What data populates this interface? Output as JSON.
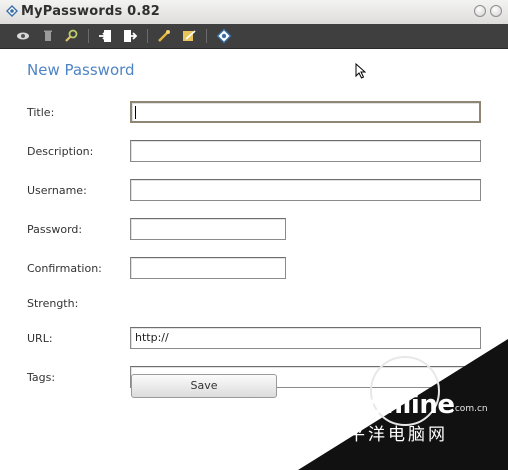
{
  "window": {
    "title": "MyPasswords 0.82",
    "icons": [
      "app-logo-icon",
      "minimize-icon",
      "close-icon"
    ]
  },
  "toolbar": {
    "buttons": [
      "view-icon",
      "delete-icon",
      "search-icon",
      "import-icon",
      "export-icon",
      "generate-key-icon",
      "edit-icon",
      "about-icon"
    ]
  },
  "form": {
    "heading": "New Password",
    "labels": {
      "title": "Title:",
      "description": "Description:",
      "username": "Username:",
      "password": "Password:",
      "confirmation": "Confirmation:",
      "strength": "Strength:",
      "url": "URL:",
      "tags": "Tags:"
    },
    "values": {
      "title": "",
      "description": "",
      "username": "",
      "password": "",
      "confirmation": "",
      "url": "http://",
      "tags": ""
    },
    "save_label": "Save"
  },
  "watermark": {
    "logo": "PConline",
    "domain": ".com.cn",
    "chinese": "太平洋电脑网"
  },
  "colors": {
    "heading": "#4f84c4",
    "toolbar_bg": "#3f3f3f",
    "active_border": "#8f8676"
  }
}
